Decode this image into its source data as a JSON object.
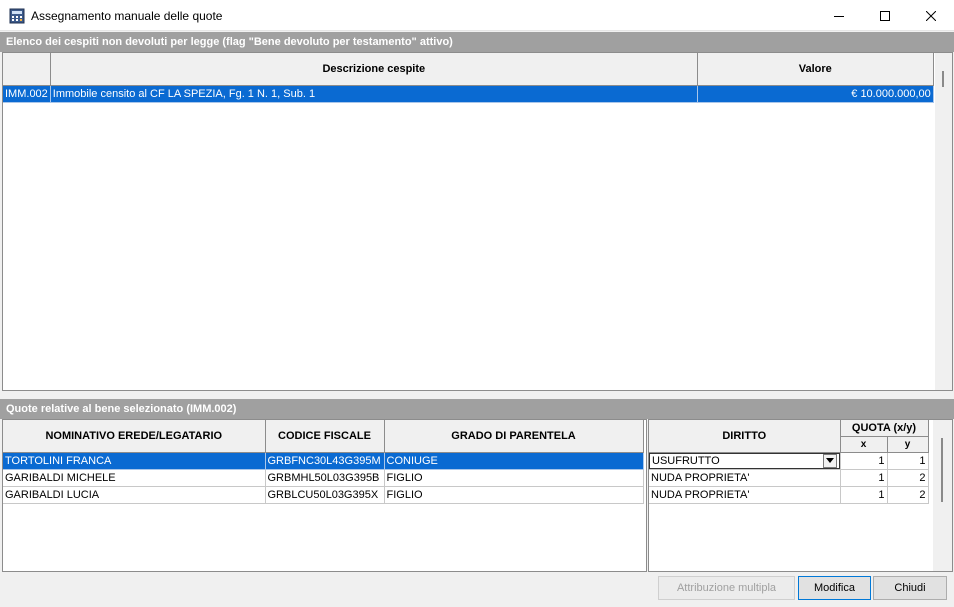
{
  "window": {
    "title": "Assegnamento manuale delle quote"
  },
  "section1": {
    "title": "Elenco dei cespiti non devoluti per legge (flag \"Bene devoluto per testamento\" attivo)",
    "columns": [
      "",
      "Descrizione cespite",
      "Valore"
    ],
    "rows": [
      {
        "code": "IMM.002",
        "description": "Immobile censito al CF LA SPEZIA, Fg. 1 N. 1, Sub. 1",
        "value": "€ 10.000.000,00"
      }
    ]
  },
  "section2": {
    "title": "Quote relative al bene selezionato (IMM.002)",
    "columns": [
      "NOMINATIVO EREDE/LEGATARIO",
      "CODICE FISCALE",
      "GRADO DI PARENTELA"
    ],
    "rows": [
      {
        "name": "TORTOLINI FRANCA",
        "cf": "GRBFNC30L43G395M",
        "grado": "CONIUGE"
      },
      {
        "name": "GARIBALDI MICHELE",
        "cf": "GRBMHL50L03G395B",
        "grado": "FIGLIO"
      },
      {
        "name": "GARIBALDI LUCIA",
        "cf": "GRBLCU50L03G395X",
        "grado": "FIGLIO"
      }
    ],
    "right": {
      "diritto_header": "DIRITTO",
      "quota_header": "QUOTA (x/y)",
      "x_header": "x",
      "y_header": "y",
      "rows": [
        {
          "diritto": "USUFRUTTO",
          "x": "1",
          "y": "1"
        },
        {
          "diritto": "NUDA PROPRIETA'",
          "x": "1",
          "y": "2"
        },
        {
          "diritto": "NUDA PROPRIETA'",
          "x": "1",
          "y": "2"
        }
      ]
    }
  },
  "buttons": {
    "multi": "Attribuzione multipla",
    "modify": "Modifica",
    "close": "Chiudi"
  },
  "icons": {
    "app": "calculator-app-icon",
    "minimize": "minimize-icon",
    "maximize": "maximize-icon",
    "close": "close-icon",
    "dropdown": "chevron-down-icon"
  },
  "colors": {
    "selection": "#0a6ad2",
    "section_bar": "#a0a0a0"
  }
}
